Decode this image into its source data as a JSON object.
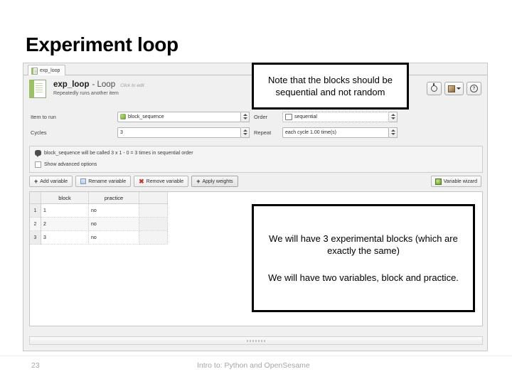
{
  "slide": {
    "title": "Experiment loop"
  },
  "window": {
    "tab": {
      "label": "exp_loop",
      "icon": "loop-item-icon"
    },
    "header": {
      "item_name": "exp_loop",
      "item_type": "- Loop",
      "edit_hint": "Click to edit",
      "description": "Repeatedly runs another item",
      "tools": [
        {
          "name": "run-item-button",
          "icon": "run-icon"
        },
        {
          "name": "open-documentation-button",
          "icon": "book-icon"
        },
        {
          "name": "help-button",
          "icon": "question-mark-icon",
          "glyph": "?"
        }
      ]
    },
    "form": {
      "item_to_run_label": "Item to run",
      "item_to_run_value": "block_sequence",
      "order_label": "Order",
      "order_value": "sequential",
      "cycles_label": "Cycles",
      "cycles_value": "3",
      "repeat_label": "Repeat",
      "repeat_value": "each cycle 1.00 time(s)"
    },
    "info": {
      "message": "block_sequence will be called 3 x 1 - 0 = 3 times in sequential order",
      "advanced_label": "Show advanced options"
    },
    "variable_toolbar": {
      "add_variable": "Add variable",
      "rename_variable": "Rename variable",
      "remove_variable": "Remove variable",
      "apply_weights": "Apply weights",
      "variable_wizard": "Variable wizard"
    },
    "table": {
      "columns": [
        "",
        "block",
        "practice",
        ""
      ],
      "rows": [
        {
          "num": "1",
          "block": "1",
          "practice": "no"
        },
        {
          "num": "2",
          "block": "2",
          "practice": "no"
        },
        {
          "num": "3",
          "block": "3",
          "practice": "no"
        }
      ]
    }
  },
  "callouts": {
    "note": "Note that the blocks should be sequential and not random",
    "blocks_line1": "We will have 3 experimental blocks (which are exactly the same)",
    "blocks_line2": "We will have two variables, block and practice."
  },
  "footer": {
    "page_number": "23",
    "deck_title": "Intro to: Python and OpenSesame"
  }
}
